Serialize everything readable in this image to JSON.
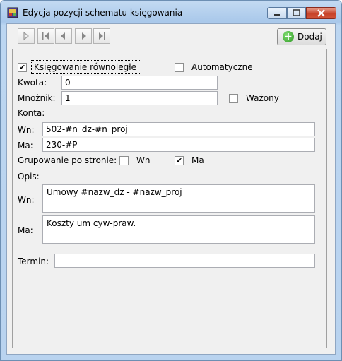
{
  "window": {
    "title": "Edycja pozycji schematu księgowania"
  },
  "toolbar": {
    "nav_icons": [
      "new-record-icon",
      "first-record-icon",
      "previous-record-icon",
      "next-record-icon",
      "last-record-icon"
    ],
    "add_label": "Dodaj"
  },
  "form": {
    "ksiegowanie_rownolegle": {
      "label": "Księgowanie równoległe",
      "checked": true
    },
    "automatyczne": {
      "label": "Automatyczne",
      "checked": false
    },
    "kwota": {
      "label": "Kwota:",
      "value": "0"
    },
    "mnoznik": {
      "label": "Mnożnik:",
      "value": "1"
    },
    "wazony": {
      "label": "Ważony",
      "checked": false
    },
    "konta_label": "Konta:",
    "konto_wn": {
      "label": "Wn:",
      "value": "502-#n_dz-#n_proj"
    },
    "konto_ma": {
      "label": "Ma:",
      "value": "230-#P"
    },
    "grupowanie": {
      "label": "Grupowanie po stronie:",
      "wn": {
        "label": "Wn",
        "checked": false
      },
      "ma": {
        "label": "Ma",
        "checked": true
      }
    },
    "opis_label": "Opis:",
    "opis_wn": {
      "label": "Wn:",
      "value": "Umowy #nazw_dz - #nazw_proj"
    },
    "opis_ma": {
      "label": "Ma:",
      "value": "Koszty um cyw-praw."
    },
    "termin": {
      "label": "Termin:",
      "value": ""
    }
  },
  "colors": {
    "title_bar": "#b9d3ef",
    "close_button": "#c7432a",
    "add_icon": "#2f9a25"
  }
}
